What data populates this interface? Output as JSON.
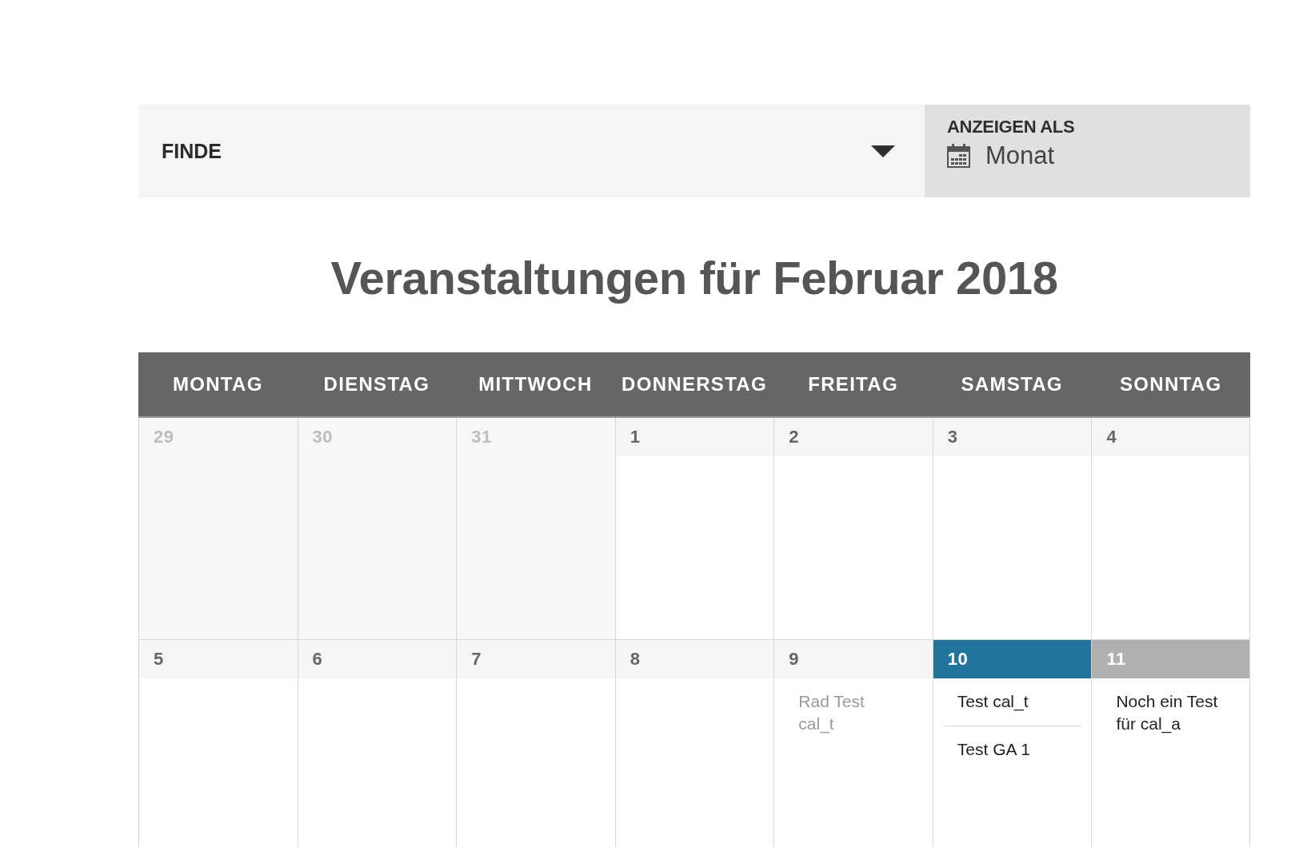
{
  "filter_bar": {
    "search_label": "FINDE",
    "view": {
      "label": "ANZEIGEN ALS",
      "value": "Monat"
    }
  },
  "heading": "Veranstaltungen für Februar 2018",
  "calendar": {
    "weekdays": [
      "MONTAG",
      "DIENSTAG",
      "MITTWOCH",
      "DONNERSTAG",
      "FREITAG",
      "SAMSTAG",
      "SONNTAG"
    ],
    "weeks": [
      {
        "days": [
          {
            "day": "29",
            "kind": "other-month"
          },
          {
            "day": "30",
            "kind": "other-month"
          },
          {
            "day": "31",
            "kind": "other-month"
          },
          {
            "day": "1",
            "kind": "past"
          },
          {
            "day": "2",
            "kind": "past"
          },
          {
            "day": "3",
            "kind": "past"
          },
          {
            "day": "4",
            "kind": "past"
          }
        ]
      },
      {
        "days": [
          {
            "day": "5",
            "kind": "past"
          },
          {
            "day": "6",
            "kind": "past"
          },
          {
            "day": "7",
            "kind": "past"
          },
          {
            "day": "8",
            "kind": "past"
          },
          {
            "day": "9",
            "kind": "past",
            "events": [
              {
                "title": "Rad Test cal_t",
                "past": true
              }
            ]
          },
          {
            "day": "10",
            "kind": "today",
            "events": [
              {
                "title": "Test cal_t",
                "past": false
              },
              {
                "title": "Test GA 1",
                "past": false
              }
            ]
          },
          {
            "day": "11",
            "kind": "future",
            "events": [
              {
                "title": "Noch ein Test für cal_a",
                "past": false
              }
            ]
          }
        ]
      }
    ]
  }
}
